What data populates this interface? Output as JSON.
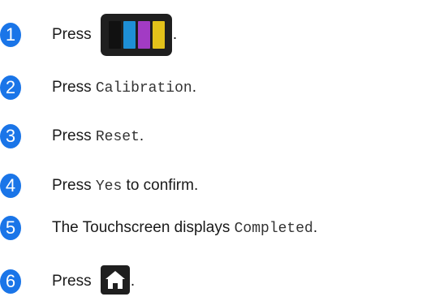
{
  "badge_color": "#1a75e8",
  "steps": [
    {
      "num": "1",
      "text_before": "Press",
      "text_after": ".",
      "icon": "ink-cartridge-icon"
    },
    {
      "num": "2",
      "text_before": "Press ",
      "code": "Calibration",
      "text_after": "."
    },
    {
      "num": "3",
      "text_before": "Press ",
      "code": "Reset",
      "text_after": "."
    },
    {
      "num": "4",
      "text_before": "Press ",
      "code": "Yes",
      "text_after": " to confirm."
    },
    {
      "num": "5",
      "text_before": "The Touchscreen displays ",
      "code": "Completed",
      "text_after": "."
    },
    {
      "num": "6",
      "text_before": "Press",
      "text_after": ".",
      "icon": "home-icon"
    }
  ],
  "ink_colors": [
    "#111111",
    "#1e8fd6",
    "#a23bc4",
    "#e3c21a"
  ]
}
